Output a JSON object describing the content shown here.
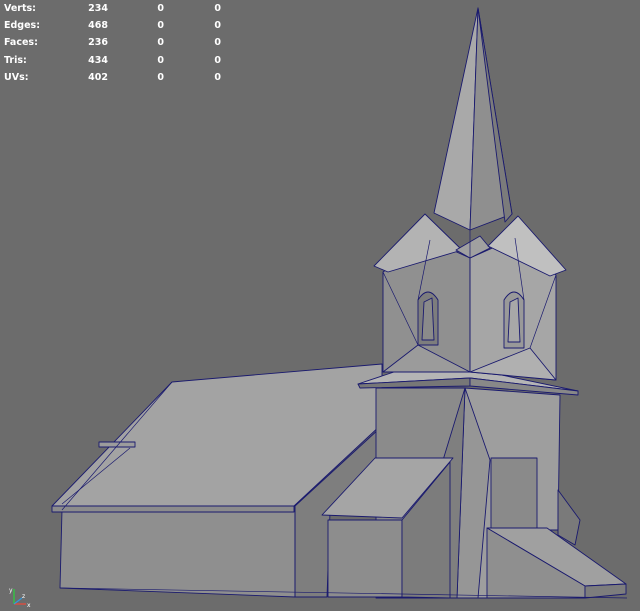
{
  "hud": {
    "rows": [
      {
        "label": "Verts:",
        "v1": "234",
        "v2": "0",
        "v3": "0"
      },
      {
        "label": "Edges:",
        "v1": "468",
        "v2": "0",
        "v3": "0"
      },
      {
        "label": "Faces:",
        "v1": "236",
        "v2": "0",
        "v3": "0"
      },
      {
        "label": "Tris:",
        "v1": "434",
        "v2": "0",
        "v3": "0"
      },
      {
        "label": "UVs:",
        "v1": "402",
        "v2": "0",
        "v3": "0"
      }
    ]
  },
  "axis_gizmo": {
    "x_label": "x",
    "y_label": "y",
    "z_label": "z"
  },
  "colors": {
    "viewport_bg": "#6c6c6c",
    "mesh_face": "#9a9a9a",
    "mesh_face_dark": "#828282",
    "mesh_face_light": "#b0b0b0",
    "wireframe": "#1a1a6e",
    "hud_text": "#ffffff"
  },
  "scene_object": "church-model"
}
